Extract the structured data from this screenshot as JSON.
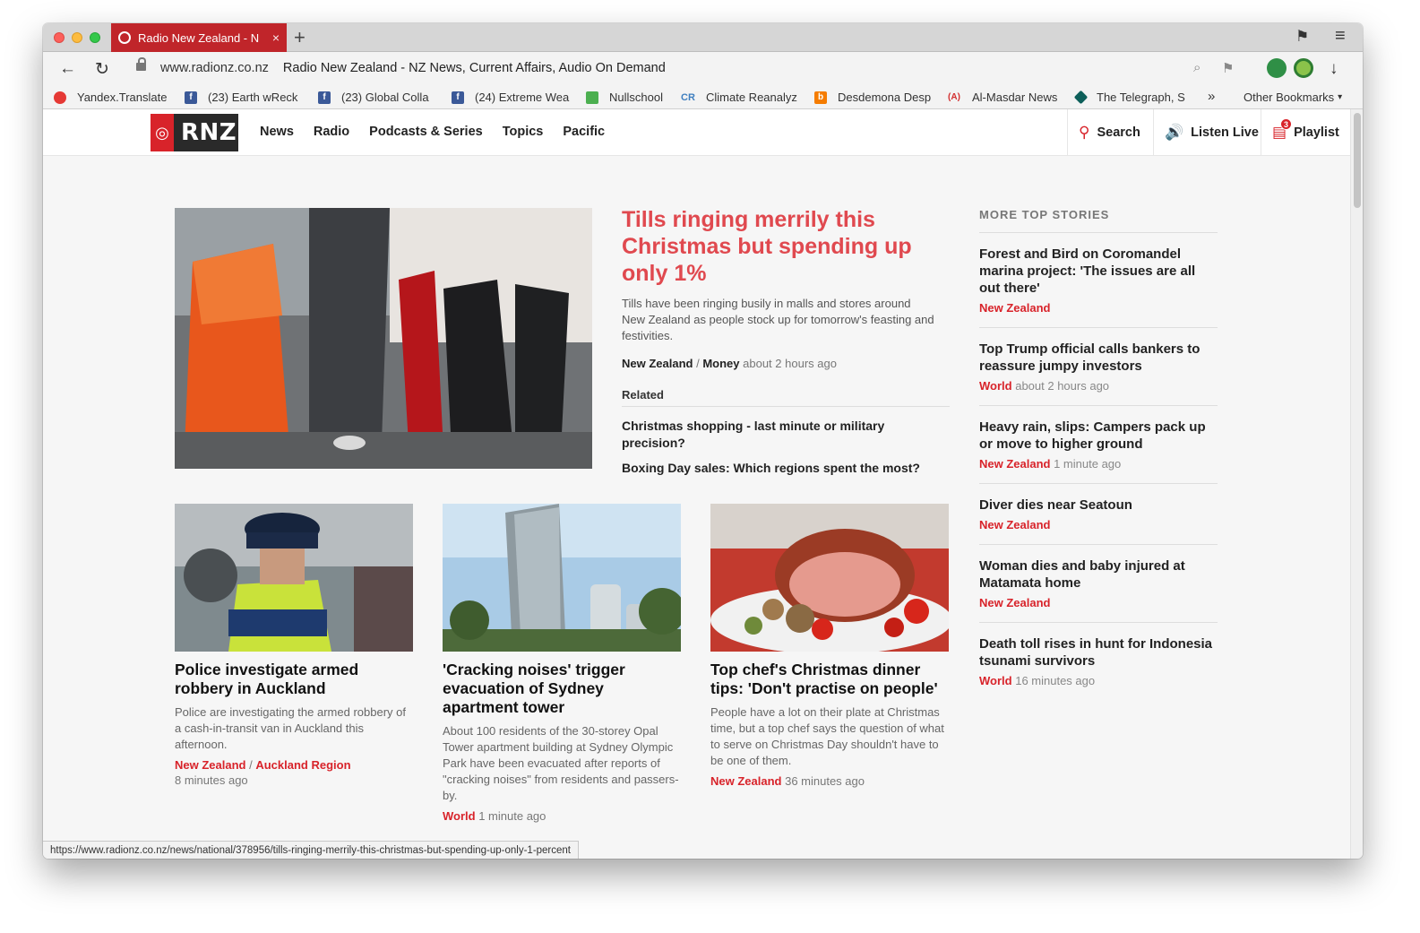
{
  "browser": {
    "tab_title": "Radio New Zealand - N",
    "tab_close": "×",
    "new_tab": "+",
    "url_domain": "www.radionz.co.nz",
    "url_title": "Radio New Zealand - NZ News, Current Affairs, Audio On Demand",
    "status_url": "https://www.radionz.co.nz/news/national/378956/tills-ringing-merrily-this-christmas-but-spending-up-only-1-percent",
    "icons": {
      "back": "←",
      "reload": "↻",
      "menu": "≡",
      "download": "↓",
      "bookmark": "⚑",
      "search": "⌕",
      "more": "»",
      "caret": "▾"
    }
  },
  "bookmarks": [
    {
      "label": "Yandex.Translate",
      "icon": "yandex-translate-icon"
    },
    {
      "label": "(23) Earth wReck",
      "icon": "facebook-icon"
    },
    {
      "label": "(23) Global Colla",
      "icon": "facebook-icon"
    },
    {
      "label": "(24) Extreme Wea",
      "icon": "facebook-icon"
    },
    {
      "label": "Nullschool",
      "icon": "nullschool-icon"
    },
    {
      "label": "Climate Reanalyz",
      "icon": "cr-icon"
    },
    {
      "label": "Desdemona Desp",
      "icon": "blogger-icon"
    },
    {
      "label": "Al-Masdar News",
      "icon": "almasdar-icon"
    },
    {
      "label": "The Telegraph, S",
      "icon": "telegraph-icon"
    },
    {
      "label": "Other Bookmarks",
      "icon": "folder-icon"
    }
  ],
  "site": {
    "logo_text": "RNZ",
    "nav": [
      "News",
      "Radio",
      "Podcasts & Series",
      "Topics",
      "Pacific"
    ],
    "search_label": "Search",
    "listen_label": "Listen Live",
    "playlist_label": "Playlist",
    "playlist_count": "3"
  },
  "hero": {
    "title": "Tills ringing merrily this Christmas but spending up only 1%",
    "summary": "Tills have been ringing busily in malls and stores around New Zealand as people stock up for tomorrow's feasting and festivities.",
    "tag1": "New Zealand",
    "sep": "/",
    "tag2": "Money",
    "time": "about 2 hours ago",
    "related_label": "Related",
    "related": [
      "Christmas shopping - last minute or military precision?",
      "Boxing Day sales: Which regions spent the most?"
    ]
  },
  "cards": [
    {
      "title": "Police investigate armed robbery in Auckland",
      "summary": "Police are investigating the armed robbery of a cash-in-transit van in Auckland this afternoon.",
      "tag1": "New Zealand",
      "sep": "/",
      "tag2": "Auckland Region",
      "time": "8 minutes ago"
    },
    {
      "title": "'Cracking noises' trigger evacuation of Sydney apartment tower",
      "summary": "About 100 residents of the 30-storey Opal Tower apartment building at Sydney Olympic Park have been evacuated after reports of \"cracking noises\" from residents and passers-by.",
      "tag1": "World",
      "time": "1 minute ago"
    },
    {
      "title": "Top chef's Christmas dinner tips: 'Don't practise on people'",
      "summary": "People have a lot on their plate at Christmas time, but a top chef says the question of what to serve on Christmas Day shouldn't have to be one of them.",
      "tag1": "New Zealand",
      "time": "36 minutes ago"
    }
  ],
  "sidebar": {
    "heading": "MORE TOP STORIES",
    "items": [
      {
        "title": "Forest and Bird on Coromandel marina project: 'The issues are all out there'",
        "tag": "New Zealand",
        "time": ""
      },
      {
        "title": "Top Trump official calls bankers to reassure jumpy investors",
        "tag": "World",
        "time": "about 2 hours ago"
      },
      {
        "title": "Heavy rain, slips: Campers pack up or move to higher ground",
        "tag": "New Zealand",
        "time": "1 minute ago"
      },
      {
        "title": "Diver dies near Seatoun",
        "tag": "New Zealand",
        "time": ""
      },
      {
        "title": "Woman dies and baby injured at Matamata home",
        "tag": "New Zealand",
        "time": ""
      },
      {
        "title": "Death toll rises in hunt for Indonesia tsunami survivors",
        "tag": "World",
        "time": "16 minutes ago"
      }
    ]
  },
  "colors": {
    "brand_red": "#d8232a",
    "headline_red": "#e0494f"
  }
}
